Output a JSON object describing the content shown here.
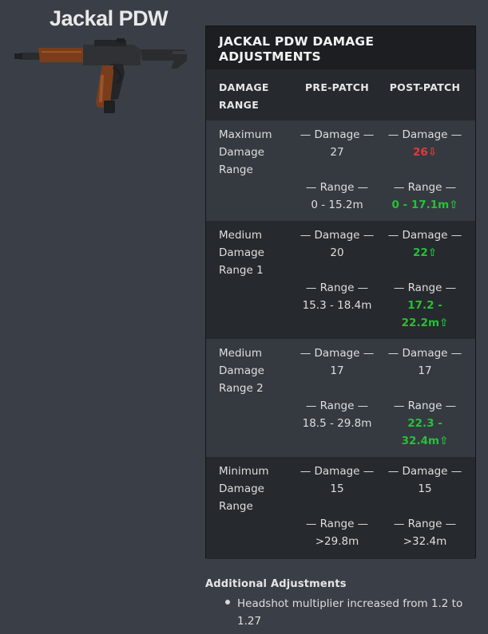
{
  "weapon": {
    "title": "Jackal PDW",
    "image_icon": "smg-weapon-icon"
  },
  "panel": {
    "header": "JACKAL PDW DAMAGE ADJUSTMENTS",
    "columns": {
      "range": "DAMAGE RANGE",
      "pre": "PRE-PATCH",
      "post": "POST-PATCH"
    }
  },
  "rows": [
    {
      "name": "Maximum Damage Range",
      "pre_damage_label": "— Damage —",
      "pre_damage": "27",
      "post_damage_label": "— Damage —",
      "post_damage": "26⇩",
      "pre_range_label": "— Range —",
      "pre_range": "0 - 15.2m",
      "post_range_label": "— Range —",
      "post_range": "0 - 17.1m⇧"
    },
    {
      "name": "Medium Damage Range 1",
      "pre_damage_label": "— Damage —",
      "pre_damage": "20",
      "post_damage_label": "— Damage —",
      "post_damage": "22⇧",
      "pre_range_label": "— Range —",
      "pre_range": "15.3 - 18.4m",
      "post_range_label": "— Range —",
      "post_range": "17.2 - 22.2m⇧"
    },
    {
      "name": "Medium Damage Range 2",
      "pre_damage_label": "— Damage —",
      "pre_damage": "17",
      "post_damage_label": "— Damage —",
      "post_damage": "17",
      "pre_range_label": "— Range —",
      "pre_range": "18.5 - 29.8m",
      "post_range_label": "— Range —",
      "post_range": "22.3 - 32.4m⇧"
    },
    {
      "name": "Minimum Damage Range",
      "pre_damage_label": "— Damage —",
      "pre_damage": "15",
      "post_damage_label": "— Damage —",
      "post_damage": "15",
      "pre_range_label": "— Range —",
      "pre_range": ">29.8m",
      "post_range_label": "— Range —",
      "post_range": ">32.4m"
    }
  ],
  "additional": {
    "title": "Additional Adjustments",
    "items": [
      "Headshot multiplier increased from 1.2 to 1.27"
    ]
  },
  "colors": {
    "decrease": "#e23a3a",
    "increase": "#27c03a"
  }
}
